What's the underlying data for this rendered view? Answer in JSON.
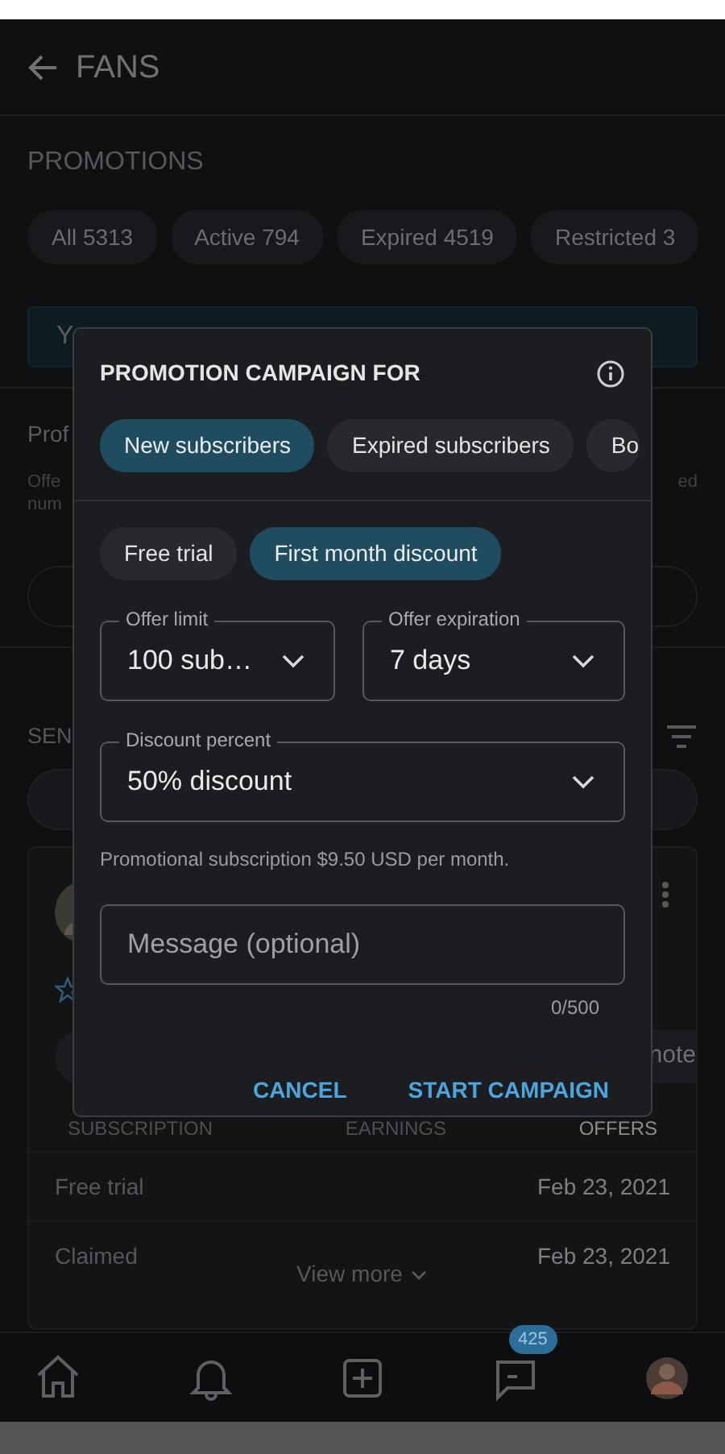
{
  "header": {
    "title": "FANS"
  },
  "section_title": "PROMOTIONS",
  "filters": [
    {
      "label": "All 5313",
      "selected": false
    },
    {
      "label": "Active 794",
      "selected": false
    },
    {
      "label": "Expired 4519",
      "selected": false
    },
    {
      "label": "Restricted 3",
      "selected": false
    }
  ],
  "banner": {
    "text": "Y"
  },
  "profile_section": {
    "title": "Prof",
    "description_lines": [
      "Offe",
      "num"
    ],
    "right_text": "ed"
  },
  "sent_section": {
    "title": "SEN"
  },
  "card": {
    "action_text": "note",
    "columns": [
      {
        "label": "SUBSCRIPTION",
        "selected": false
      },
      {
        "label": "EARNINGS",
        "selected": false
      },
      {
        "label": "OFFERS",
        "selected": true
      }
    ],
    "rows": [
      {
        "label": "Free trial",
        "date": "Feb 23, 2021"
      },
      {
        "label": "Claimed",
        "date": "Feb 23, 2021"
      }
    ],
    "view_more": "View more"
  },
  "dialog": {
    "title": "PROMOTION CAMPAIGN FOR",
    "audiences": [
      {
        "label": "New subscribers",
        "selected": true
      },
      {
        "label": "Expired subscribers",
        "selected": false
      },
      {
        "label": "Bo",
        "selected": false
      }
    ],
    "offer_types": [
      {
        "label": "Free trial",
        "selected": false
      },
      {
        "label": "First month discount",
        "selected": true
      }
    ],
    "selects": [
      {
        "label": "Offer limit",
        "value": "100 sub…"
      },
      {
        "label": "Offer expiration",
        "value": "7 days"
      },
      {
        "label": "Discount percent",
        "value": "50% discount"
      }
    ],
    "note": "Promotional subscription $9.50 USD per month.",
    "message": {
      "placeholder": "Message (optional)",
      "counter": "0/500"
    },
    "buttons": [
      "CANCEL",
      "START CAMPAIGN"
    ]
  },
  "bottom_nav": [
    {
      "kind": "home"
    },
    {
      "kind": "bell"
    },
    {
      "kind": "add"
    },
    {
      "kind": "messages",
      "badge": "425"
    },
    {
      "kind": "avatar"
    }
  ]
}
